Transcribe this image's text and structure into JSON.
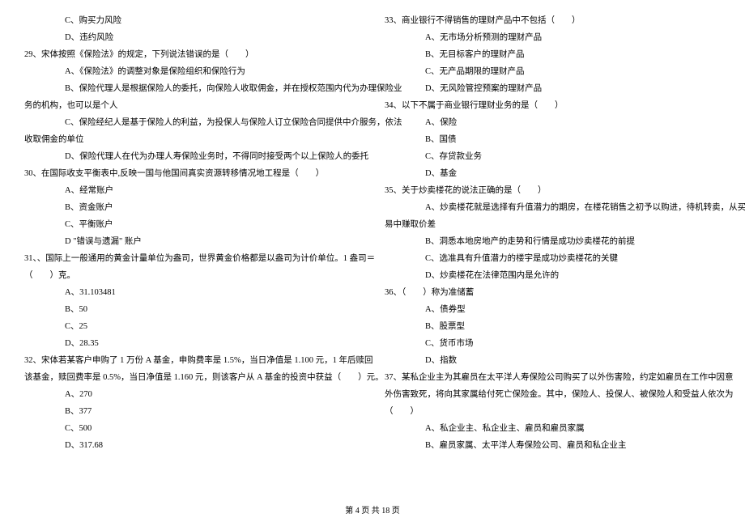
{
  "left_col": {
    "pre_options": [
      {
        "label": "C、购买力风险"
      },
      {
        "label": "D、违约风险"
      }
    ],
    "q29": {
      "text": "29、宋体按照《保险法》的规定，下列说法错误的是（　　）",
      "options": [
        "A、《保险法》的调整对象是保险组织和保险行为",
        "B、保险代理人是根据保险人的委托，向保险人收取佣金，并在授权范围内代为办理保险业",
        "务的机构，也可以是个人",
        "C、保险经纪人是基于保险人的利益，为投保人与保险人订立保险合同提供中介服务，依法",
        "收取佣金的单位",
        "D、保险代理人在代为办理人寿保险业务时，不得同时接受两个以上保险人的委托"
      ]
    },
    "q30": {
      "text": "30、在国际收支平衡表中,反映一国与他国间真实资源转移情况地工程是（　　）",
      "options": [
        "A、经常账户",
        "B、资金账户",
        "C、平衡账户",
        "D \"错误与遗漏\" 账户"
      ]
    },
    "q31": {
      "text_line1": "31、、国际上一般通用的黄金计量单位为盎司，世界黄金价格都是以盎司为计价单位。1 盎司＝",
      "text_line2": "（　　）克。",
      "options": [
        "A、31.103481",
        "B、50",
        "C、25",
        "D、28.35"
      ]
    },
    "q32": {
      "text_line1": "32、宋体若某客户申购了 1 万份 A 基金，申购费率是 1.5%，当日净值是 1.100 元，1 年后赎回",
      "text_line2": "该基金，赎回费率是 0.5%，当日净值是 1.160 元，则该客户从 A 基金的投资中获益（　　）元。",
      "options": [
        "A、270",
        "B、377",
        "C、500",
        "D、317.68"
      ]
    }
  },
  "right_col": {
    "q33": {
      "text": "33、商业银行不得销售的理财产品中不包括（　　）",
      "options": [
        "A、无市场分析预测的理财产品",
        "B、无目标客户的理财产品",
        "C、无产品期限的理财产品",
        "D、无风险管控预案的理财产品"
      ]
    },
    "q34": {
      "text": "34、以下不属于商业银行理财业务的是（　　）",
      "options": [
        "A、保险",
        "B、国债",
        "C、存贷款业务",
        "D、基金"
      ]
    },
    "q35": {
      "text": "35、关于炒卖楼花的说法正确的是（　　）",
      "options": [
        "A、炒卖楼花就是选择有升值潜力的期房，在楼花销售之初予以购进，待机转卖，从买卖交",
        "易中赚取价差",
        "B、洞悉本地房地产的走势和行情是成功炒卖楼花的前提",
        "C、选准具有升值潜力的楼宇是成功炒卖楼花的关键",
        "D、炒卖楼花在法律范围内是允许的"
      ]
    },
    "q36": {
      "text": "36、（　　）称为准储蓄",
      "options": [
        "A、债券型",
        "B、股票型",
        "C、货币市场",
        "D、指数"
      ]
    },
    "q37": {
      "text_line1": "37、某私企业主为其雇员在太平洋人寿保险公司购买了以外伤害险，约定如雇员在工作中因意",
      "text_line2": "外伤害致死，将向其家属给付死亡保险金。其中，保险人、投保人、被保险人和受益人依次为",
      "text_line3": "（　　）",
      "options": [
        "A、私企业主、私企业主、雇员和雇员家属",
        "B、雇员家属、太平洋人寿保险公司、雇员和私企业主"
      ]
    }
  },
  "footer": "第 4 页 共 18 页"
}
